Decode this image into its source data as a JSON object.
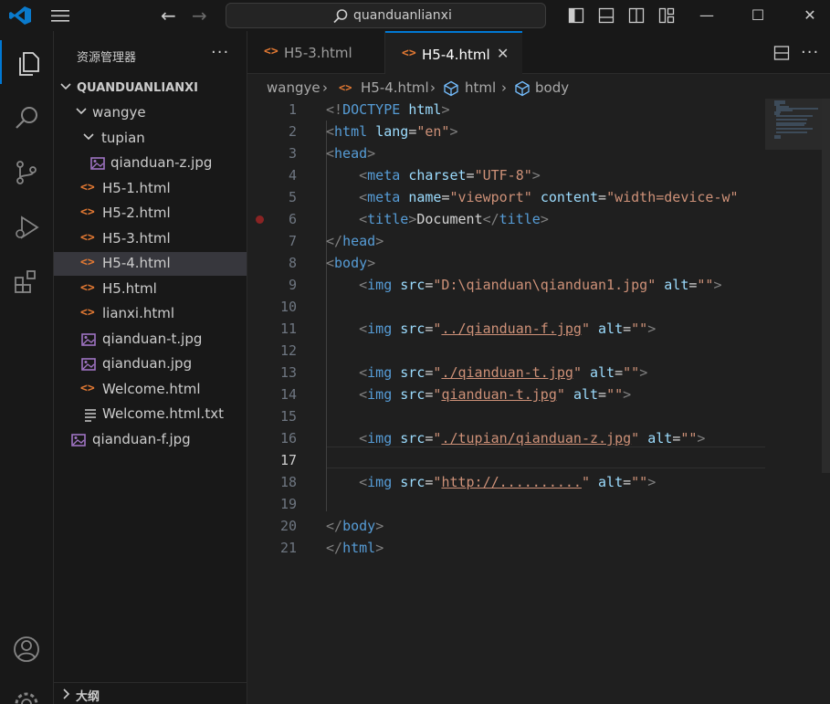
{
  "titlebar": {
    "search_text": "quanduanlianxi"
  },
  "explorer": {
    "title": "资源管理器",
    "more": "···",
    "root": "QUANDUANLIANXI",
    "items": [
      {
        "label": "wangye",
        "kind": "folder"
      },
      {
        "label": "tupian",
        "kind": "folder"
      },
      {
        "label": "qianduan-z.jpg",
        "kind": "image"
      },
      {
        "label": "H5-1.html",
        "kind": "html"
      },
      {
        "label": "H5-2.html",
        "kind": "html"
      },
      {
        "label": "H5-3.html",
        "kind": "html"
      },
      {
        "label": "H5-4.html",
        "kind": "html",
        "selected": true
      },
      {
        "label": "H5.html",
        "kind": "html"
      },
      {
        "label": "lianxi.html",
        "kind": "html"
      },
      {
        "label": "qianduan-t.jpg",
        "kind": "image"
      },
      {
        "label": "qianduan.jpg",
        "kind": "image"
      },
      {
        "label": "Welcome.html",
        "kind": "html"
      },
      {
        "label": "Welcome.html.txt",
        "kind": "text"
      },
      {
        "label": "qianduan-f.jpg",
        "kind": "image"
      }
    ],
    "outline": "大纲"
  },
  "tabs": [
    {
      "label": "H5-3.html",
      "active": false
    },
    {
      "label": "H5-4.html",
      "active": true
    }
  ],
  "breadcrumb": [
    "wangye",
    "H5-4.html",
    "html",
    "body"
  ],
  "editor": {
    "current_line": 17,
    "breakpoint_line": 6,
    "line_numbers": [
      "1",
      "2",
      "3",
      "4",
      "5",
      "6",
      "7",
      "8",
      "9",
      "10",
      "11",
      "12",
      "13",
      "14",
      "15",
      "16",
      "17",
      "18",
      "19",
      "20",
      "21"
    ],
    "lines": [
      "<!DOCTYPE html>",
      "<html lang=\"en\">",
      "<head>",
      "    <meta charset=\"UTF-8\">",
      "    <meta name=\"viewport\" content=\"width=device-wi",
      "    <title>Document</title>",
      "</head>",
      "<body>",
      "    <img src=\"D:\\qianduan\\qianduan1.jpg\" alt=\"\">",
      "",
      "    <img src=\"../qianduan-f.jpg\" alt=\"\">",
      "",
      "    <img src=\"./qianduan-t.jpg\" alt=\"\">",
      "    <img src=\"qianduan-t.jpg\" alt=\"\">",
      "",
      "    <img src=\"./tupian/qianduan-z.jpg\" alt=\"\">",
      "",
      "    <img src=\"http://..........\" alt=\"\">",
      "",
      "</body>",
      "</html>"
    ]
  },
  "colors": {
    "accent": "#0078d4",
    "html_icon": "#e37933",
    "image_icon": "#a074c4",
    "tag": "#569cd6",
    "attribute": "#9cdcfe",
    "string": "#ce9178"
  }
}
